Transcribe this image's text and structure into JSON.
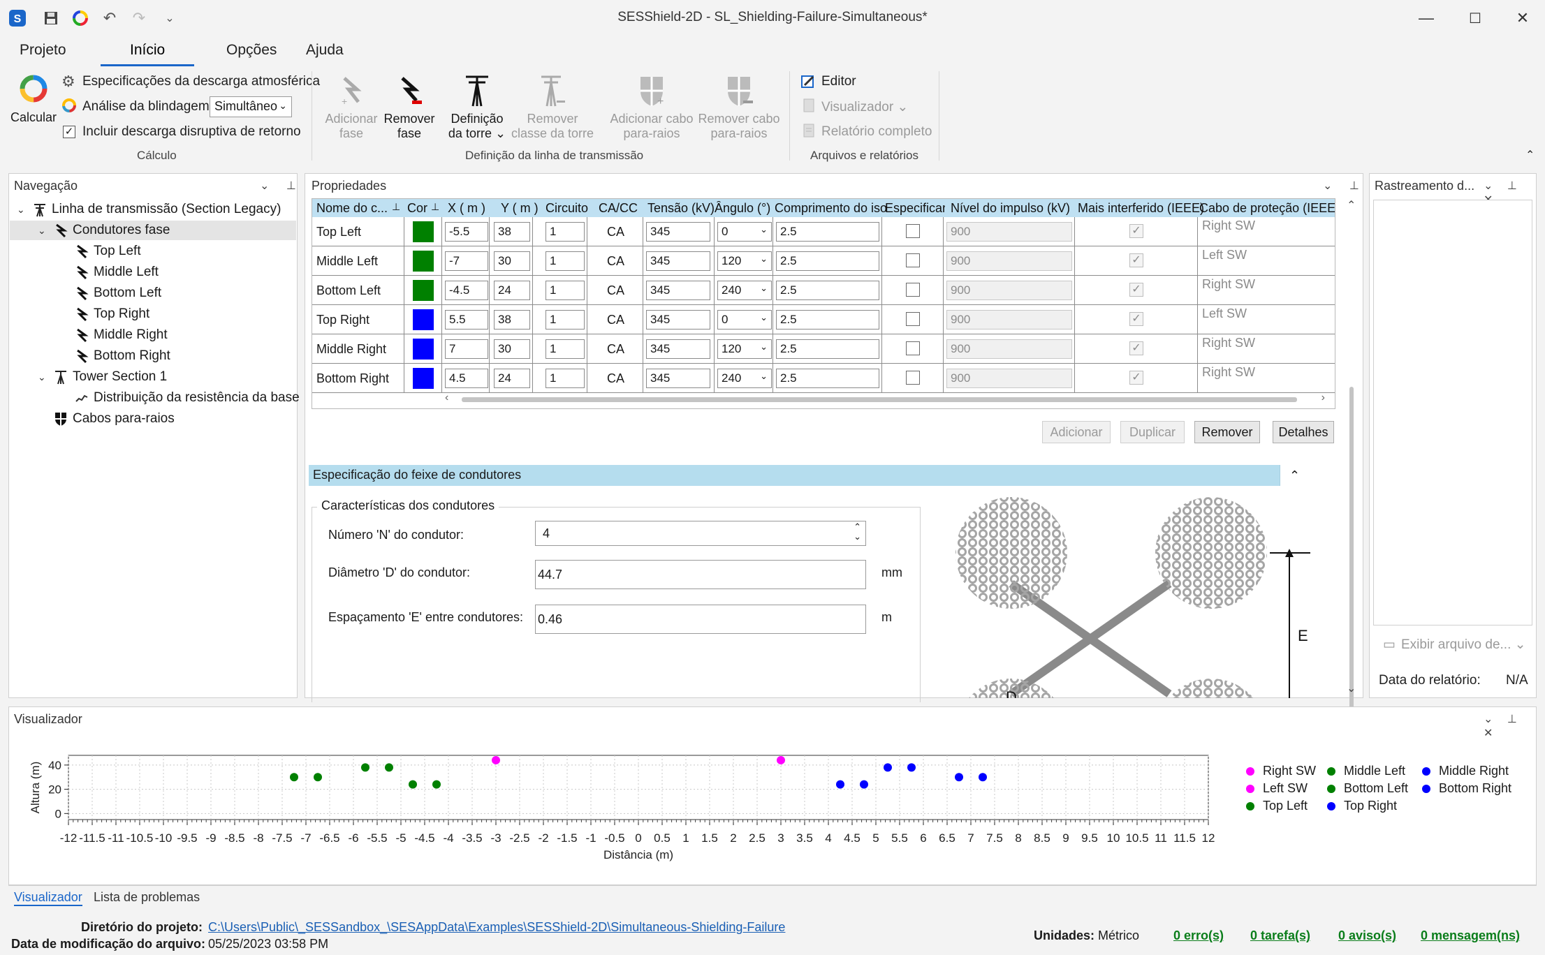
{
  "window": {
    "title": "SESShield-2D - SL_Shielding-Failure-Simultaneous*"
  },
  "ribbon_tabs": [
    "Projeto",
    "Início",
    "Opções",
    "Ajuda"
  ],
  "ribbon": {
    "calc_label": "Calcular",
    "spec_discharge": "Especificações da descarga atmosférica",
    "shield_analysis_label": "Análise da blindagem:",
    "shield_analysis_value": "Simultâneo",
    "include_backflash": "Incluir descarga disruptiva de retorno",
    "group_calc": "Cálculo",
    "add_phase": [
      "Adicionar",
      "fase"
    ],
    "remove_phase": [
      "Remover",
      "fase"
    ],
    "tower_def": [
      "Definição",
      "da torre"
    ],
    "remove_tower_class": [
      "Remover",
      "classe da torre"
    ],
    "add_shield_wire": [
      "Adicionar cabo",
      "para-raios"
    ],
    "remove_shield_wire": [
      "Remover cabo",
      "para-raios"
    ],
    "group_line": "Definição da linha de transmissão",
    "editor": "Editor",
    "viewer": "Visualizador",
    "full_report": "Relatório completo",
    "group_files": "Arquivos e relatórios"
  },
  "navigation": {
    "title": "Navegação",
    "items": [
      "Linha de transmissão (Section Legacy)",
      "Condutores fase",
      "Top Left",
      "Middle Left",
      "Bottom Left",
      "Top Right",
      "Middle Right",
      "Bottom Right",
      "Tower Section 1",
      "Distribuição da resistência da base",
      "Cabos para-raios"
    ]
  },
  "properties": {
    "title": "Propriedades",
    "columns": [
      "Nome do c...",
      "Cor",
      "X ( m )",
      "Y ( m )",
      "Circuito",
      "CA/CC",
      "Tensão (kV)",
      "Ângulo (°)",
      "Comprimento do iso",
      "Especificar",
      "Nível do impulso (kV)",
      "Mais interferido (IEEE)",
      "Cabo de proteção (IEEE)"
    ],
    "rows": [
      {
        "name": "Top Left",
        "color": "#008000",
        "x": "-5.5",
        "y": "38",
        "circuit": "1",
        "acdc": "CA",
        "voltage": "345",
        "angle": "0",
        "length": "2.5",
        "bil": "900",
        "shield": "Right SW"
      },
      {
        "name": "Middle Left",
        "color": "#008000",
        "x": "-7",
        "y": "30",
        "circuit": "1",
        "acdc": "CA",
        "voltage": "345",
        "angle": "120",
        "length": "2.5",
        "bil": "900",
        "shield": "Left SW"
      },
      {
        "name": "Bottom Left",
        "color": "#008000",
        "x": "-4.5",
        "y": "24",
        "circuit": "1",
        "acdc": "CA",
        "voltage": "345",
        "angle": "240",
        "length": "2.5",
        "bil": "900",
        "shield": "Right SW"
      },
      {
        "name": "Top Right",
        "color": "#0000ff",
        "x": "5.5",
        "y": "38",
        "circuit": "1",
        "acdc": "CA",
        "voltage": "345",
        "angle": "0",
        "length": "2.5",
        "bil": "900",
        "shield": "Left SW"
      },
      {
        "name": "Middle Right",
        "color": "#0000ff",
        "x": "7",
        "y": "30",
        "circuit": "1",
        "acdc": "CA",
        "voltage": "345",
        "angle": "120",
        "length": "2.5",
        "bil": "900",
        "shield": "Right SW"
      },
      {
        "name": "Bottom Right",
        "color": "#0000ff",
        "x": "4.5",
        "y": "24",
        "circuit": "1",
        "acdc": "CA",
        "voltage": "345",
        "angle": "240",
        "length": "2.5",
        "bil": "900",
        "shield": "Right SW"
      }
    ],
    "buttons": {
      "add": "Adicionar",
      "duplicate": "Duplicar",
      "remove": "Remover",
      "details": "Detalhes"
    }
  },
  "bundle": {
    "title": "Especificação do feixe de condutores",
    "group": "Características dos condutores",
    "n_label": "Número 'N' do condutor:",
    "n_value": "4",
    "d_label": "Diâmetro 'D' do condutor:",
    "d_value": "44.7",
    "d_unit": "mm",
    "e_label": "Espaçamento 'E' entre condutores:",
    "e_value": "0.46",
    "e_unit": "m",
    "diagram_e": "E",
    "diagram_d": "D"
  },
  "report_panel": {
    "title": "Rastreamento d...",
    "show_file": "Exibir arquivo de...",
    "report_date_label": "Data do relatório:",
    "report_date_value": "N/A"
  },
  "visualizer": {
    "title": "Visualizador",
    "tabs": [
      "Visualizador",
      "Lista de problemas"
    ]
  },
  "chart_data": {
    "type": "scatter",
    "xlabel": "Distância (m)",
    "ylabel": "Altura (m)",
    "xlim": [
      -12,
      12
    ],
    "ylim": [
      -5,
      48
    ],
    "xticks": [
      "-12",
      "-11.5",
      "-11",
      "-10.5",
      "-10",
      "-9.5",
      "-9",
      "-8.5",
      "-8",
      "-7.5",
      "-7",
      "-6.5",
      "-6",
      "-5.5",
      "-5",
      "-4.5",
      "-4",
      "-3.5",
      "-3",
      "-2.5",
      "-2",
      "-1.5",
      "-1",
      "-0.5",
      "0",
      "0.5",
      "1",
      "1.5",
      "2",
      "2.5",
      "3",
      "3.5",
      "4",
      "4.5",
      "5",
      "5.5",
      "6",
      "6.5",
      "7",
      "7.5",
      "8",
      "8.5",
      "9",
      "9.5",
      "10",
      "10.5",
      "11",
      "11.5",
      "12"
    ],
    "yticks": [
      "0",
      "20",
      "40"
    ],
    "legend_position": "right",
    "series": [
      {
        "name": "Right SW",
        "color": "#ff00ff",
        "points": [
          [
            3,
            44
          ]
        ]
      },
      {
        "name": "Left SW",
        "color": "#ff00ff",
        "points": [
          [
            -3,
            44
          ]
        ]
      },
      {
        "name": "Top Left",
        "color": "#008000",
        "points": [
          [
            -5.75,
            38
          ],
          [
            -5.25,
            38
          ]
        ]
      },
      {
        "name": "Middle Left",
        "color": "#008000",
        "points": [
          [
            -7.25,
            30
          ],
          [
            -6.75,
            30
          ]
        ]
      },
      {
        "name": "Bottom Left",
        "color": "#008000",
        "points": [
          [
            -4.75,
            24
          ],
          [
            -4.25,
            24
          ]
        ]
      },
      {
        "name": "Top Right",
        "color": "#0000ff",
        "points": [
          [
            5.25,
            38
          ],
          [
            5.75,
            38
          ]
        ]
      },
      {
        "name": "Middle Right",
        "color": "#0000ff",
        "points": [
          [
            6.75,
            30
          ],
          [
            7.25,
            30
          ]
        ]
      },
      {
        "name": "Bottom Right",
        "color": "#0000ff",
        "points": [
          [
            4.25,
            24
          ],
          [
            4.75,
            24
          ]
        ]
      }
    ],
    "legend_order": [
      "Right SW",
      "Left SW",
      "Top Left",
      "Middle Left",
      "Bottom Left",
      "Middle Right",
      "Bottom Right",
      "Top Right"
    ]
  },
  "status": {
    "project_dir_label": "Diretório do projeto:",
    "project_dir_value": "C:\\Users\\Public\\_SESSandbox_\\SESAppData\\Examples\\SESShield-2D\\Simultaneous-Shielding-Failure",
    "modified_label": "Data de modificação do arquivo:",
    "modified_value": "05/25/2023 03:58 PM",
    "units_label": "Unidades:",
    "units_value": "Métrico",
    "errors": "0 erro(s)",
    "tasks": "0 tarefa(s)",
    "warnings": "0 aviso(s)",
    "messages": "0 mensagem(ns)"
  }
}
